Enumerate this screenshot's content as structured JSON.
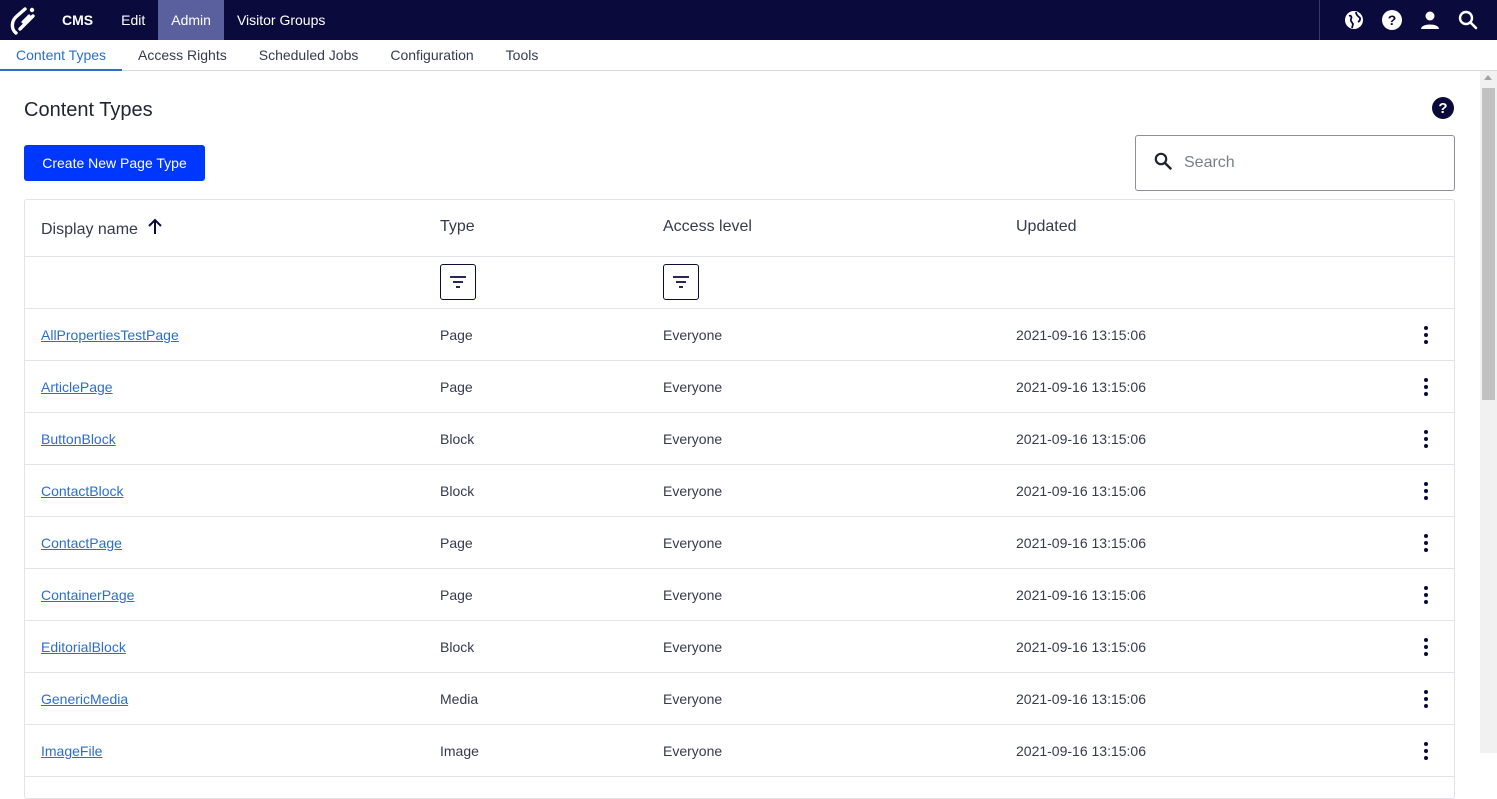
{
  "topbar": {
    "logo_icon": "optimizely-logo-icon",
    "nav": [
      {
        "label": "CMS",
        "active": false
      },
      {
        "label": "Edit",
        "active": false
      },
      {
        "label": "Admin",
        "active": true
      },
      {
        "label": "Visitor Groups",
        "active": false
      }
    ],
    "icons": [
      "globe-icon",
      "help-icon",
      "user-icon",
      "search-icon"
    ],
    "background": "#0a0a3c"
  },
  "subnav": {
    "tabs": [
      {
        "label": "Content Types",
        "active": true
      },
      {
        "label": "Access Rights",
        "active": false
      },
      {
        "label": "Scheduled Jobs",
        "active": false
      },
      {
        "label": "Configuration",
        "active": false
      },
      {
        "label": "Tools",
        "active": false
      }
    ]
  },
  "main": {
    "title": "Content Types",
    "create_button": "Create New Page Type",
    "search": {
      "placeholder": "Search",
      "value": ""
    },
    "accent_color": "#0037ff"
  },
  "table": {
    "columns": [
      {
        "label": "Display name",
        "sort": "ascending"
      },
      {
        "label": "Type"
      },
      {
        "label": "Access level"
      },
      {
        "label": "Updated"
      }
    ],
    "rows": [
      {
        "name": "AllPropertiesTestPage",
        "type": "Page",
        "access": "Everyone",
        "updated": "2021-09-16 13:15:06"
      },
      {
        "name": "ArticlePage",
        "type": "Page",
        "access": "Everyone",
        "updated": "2021-09-16 13:15:06"
      },
      {
        "name": "ButtonBlock",
        "type": "Block",
        "access": "Everyone",
        "updated": "2021-09-16 13:15:06"
      },
      {
        "name": "ContactBlock",
        "type": "Block",
        "access": "Everyone",
        "updated": "2021-09-16 13:15:06"
      },
      {
        "name": "ContactPage",
        "type": "Page",
        "access": "Everyone",
        "updated": "2021-09-16 13:15:06"
      },
      {
        "name": "ContainerPage",
        "type": "Page",
        "access": "Everyone",
        "updated": "2021-09-16 13:15:06"
      },
      {
        "name": "EditorialBlock",
        "type": "Block",
        "access": "Everyone",
        "updated": "2021-09-16 13:15:06"
      },
      {
        "name": "GenericMedia",
        "type": "Media",
        "access": "Everyone",
        "updated": "2021-09-16 13:15:06"
      },
      {
        "name": "ImageFile",
        "type": "Image",
        "access": "Everyone",
        "updated": "2021-09-16 13:15:06"
      }
    ]
  }
}
